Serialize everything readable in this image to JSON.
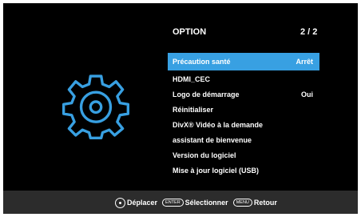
{
  "header": {
    "title": "OPTION",
    "page": "2 / 2"
  },
  "menu": {
    "items": [
      {
        "label": "Précaution santé",
        "value": "Arrêt",
        "selected": true
      },
      {
        "label": "HDMI_CEC",
        "value": ""
      },
      {
        "label": "Logo de démarrage",
        "value": "Oui"
      },
      {
        "label": "Réinitialiser",
        "value": ""
      },
      {
        "label": "DivX® Vidéo à la demande",
        "value": ""
      },
      {
        "label": "assistant de bienvenue",
        "value": ""
      },
      {
        "label": "Version du logiciel",
        "value": ""
      },
      {
        "label": "Mise à jour logiciel (USB)",
        "value": ""
      }
    ]
  },
  "footer": {
    "move_label": "Déplacer",
    "enter_key": "ENTER",
    "select_label": "Sélectionner",
    "menu_key": "MENU",
    "back_label": "Retour"
  },
  "colors": {
    "accent": "#38a0e2",
    "background": "#000000",
    "footer": "#2c2c2c"
  },
  "icons": {
    "settings": "gear-icon",
    "navigate": "dpad-icon"
  }
}
